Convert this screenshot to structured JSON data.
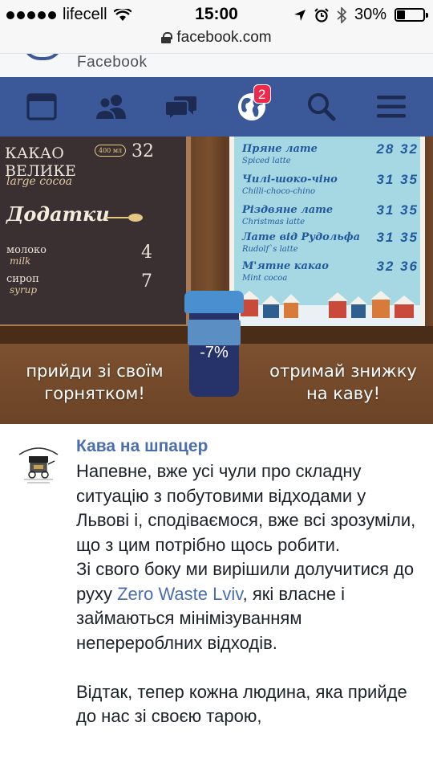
{
  "status_bar": {
    "carrier": "lifecell",
    "time": "15:00",
    "battery": "30%",
    "battery_level": 0.3
  },
  "browser": {
    "url": "facebook.com"
  },
  "page_header": {
    "title": "Facebook"
  },
  "nav": {
    "items": [
      {
        "name": "feed",
        "icon": "news-feed-icon"
      },
      {
        "name": "friends",
        "icon": "friends-icon"
      },
      {
        "name": "messages",
        "icon": "messages-icon"
      },
      {
        "name": "notifications",
        "icon": "globe-icon",
        "badge": "2"
      },
      {
        "name": "search",
        "icon": "search-icon"
      },
      {
        "name": "menu",
        "icon": "hamburger-menu-icon"
      }
    ],
    "color": "#3b5998",
    "badge_color": "#f02849"
  },
  "photo": {
    "chalkboard": {
      "item_ua": "КАКАО ВЕЛИКЕ",
      "item_en": "large cocoa",
      "item_size": "400 мл",
      "item_price": "32",
      "addons_title": "Додатки",
      "addons": [
        {
          "ua": "молоко",
          "en": "milk",
          "price": "4"
        },
        {
          "ua": "сироп",
          "en": "syrup",
          "price": "7"
        }
      ]
    },
    "menu_board": [
      {
        "ua": "Пряне лате",
        "en": "Spiced latte",
        "price": "28 32"
      },
      {
        "ua": "Чилі-шоко-чіно",
        "en": "Chilli-choco-chino",
        "price": "31 35"
      },
      {
        "ua": "Різдвяне лате",
        "en": "Christmas latte",
        "price": "31 35"
      },
      {
        "ua": "Лате від Рудольфа",
        "en": "Rudolf`s latte",
        "price": "31 35"
      },
      {
        "ua": "М'ятне какао",
        "en": "Mint cocoa",
        "price": "32 36"
      }
    ],
    "cup_label": "-7%",
    "caption_left": [
      "прийди зі своїм",
      "горнятком!"
    ],
    "caption_right": [
      "отримай знижку",
      "на каву!"
    ]
  },
  "post": {
    "page_name": "Кава на шпацер",
    "paragraphs": [
      "Напевне, вже усі чули про складну ситуацію з побутовими відходами у Львові і, сподіваємося, вже всі зрозуміли, що з цим потрібно щось робити.",
      "Зі свого боку ми вирішили долучитися до руху ",
      "Zero Waste Lviv",
      ", які власне і займаються мінімізуванням неперероблних відходів.",
      "Відтак, тепер кожна людина, яка прийде до нас зі своєю тарою,"
    ],
    "link_color": "#4b6eaf"
  }
}
